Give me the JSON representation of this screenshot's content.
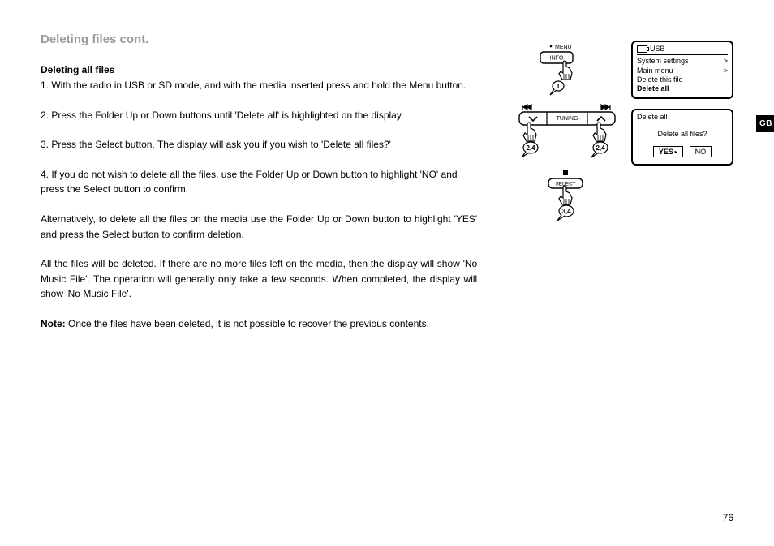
{
  "title": "Deleting files cont.",
  "subtitle": "Deleting all files",
  "steps": {
    "s1": "1. With the radio in USB or SD mode, and with the media inserted press and hold the Menu button.",
    "s2": "2. Press the Folder Up or Down buttons until 'Delete all' is highlighted on the display.",
    "s3": "3. Press the Select button. The display will ask you if you wish to 'Delete all files?'",
    "s4": "4. If you do not wish to delete all the files, use the Folder Up or Down button to highlight 'NO' and press the Select button to confirm.",
    "alt": "Alternatively, to delete all the files on the media use the Folder Up or Down button to highlight 'YES' and press the Select button to confirm deletion.",
    "result": "All the files will be deleted. If there are no more files left on the media, then the display will show 'No Music File'. The operation will generally only take a few seconds. When completed, the display will show 'No Music File'.",
    "note_label": "Note:",
    "note_text": " Once the files have been deleted, it is not possible to recover the previous contents."
  },
  "diagram": {
    "menu_label": "MENU",
    "info_label": "INFO",
    "info_callout": "1",
    "tuning_label": "TUNING",
    "left_callout": "2,4",
    "right_callout": "2,4",
    "select_label": "SELECT",
    "select_callout": "3,4"
  },
  "screen1": {
    "header_label": "USB",
    "line1": "System settings",
    "line2": "Main menu",
    "line3": "Delete this file",
    "line4": "Delete all",
    "chev": ">"
  },
  "screen2": {
    "header": "Delete all",
    "question": "Delete all files?",
    "yes": "YES",
    "no": "NO"
  },
  "side_tab": "GB",
  "page_number": "76"
}
